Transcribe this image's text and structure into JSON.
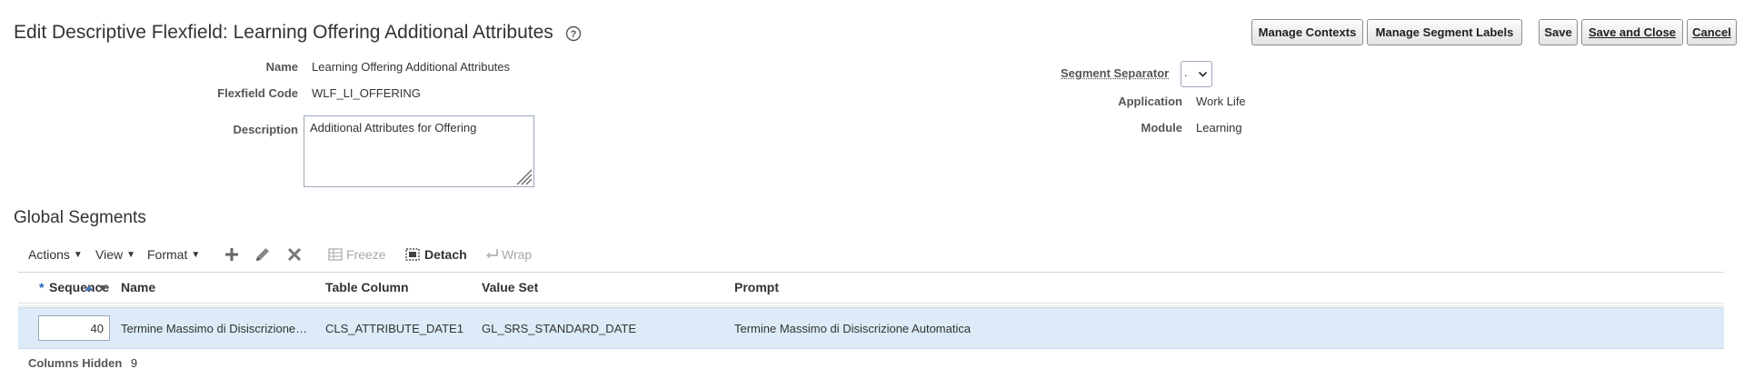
{
  "header": {
    "title": "Edit Descriptive Flexfield: Learning Offering Additional Attributes",
    "buttons": {
      "manage_contexts": "Manage Contexts",
      "manage_segment_labels": "Manage Segment Labels",
      "save": "Save",
      "save_and_close": "Save and Close",
      "cancel": "Cancel"
    }
  },
  "form": {
    "name_label": "Name",
    "name_value": "Learning Offering Additional Attributes",
    "code_label": "Flexfield Code",
    "code_value": "WLF_LI_OFFERING",
    "description_label": "Description",
    "description_value": "Additional Attributes for Offering",
    "segment_separator_label": "Segment Separator",
    "segment_separator_value": ".",
    "application_label": "Application",
    "application_value": "Work Life",
    "module_label": "Module",
    "module_value": "Learning"
  },
  "segments": {
    "section_title": "Global Segments",
    "toolbar": {
      "actions": "Actions",
      "view": "View",
      "format": "Format",
      "freeze": "Freeze",
      "detach": "Detach",
      "wrap": "Wrap"
    },
    "columns": {
      "required_marker": "*",
      "sequence": "Sequence",
      "name": "Name",
      "table_column": "Table Column",
      "value_set": "Value Set",
      "prompt": "Prompt"
    },
    "rows": [
      {
        "sequence": "40",
        "name": "Termine Massimo di Disiscrizione…",
        "table_column": "CLS_ATTRIBUTE_DATE1",
        "value_set": "GL_SRS_STANDARD_DATE",
        "prompt": "Termine Massimo di Disiscrizione Automatica"
      }
    ],
    "columns_hidden_label": "Columns Hidden",
    "columns_hidden_count": "9"
  },
  "colors": {
    "selected_row": "#dcebf7",
    "disabled_text": "#a8a8a8",
    "required_marker": "#1b64b8"
  }
}
